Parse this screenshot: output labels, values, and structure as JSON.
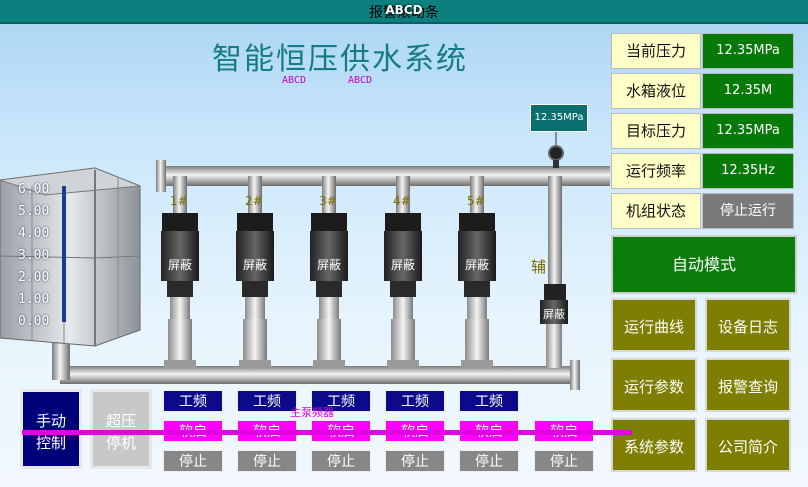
{
  "header": {
    "label": "报警滚动条",
    "overlay": "ABCD"
  },
  "title": "智能恒压供水系统",
  "subtitles": [
    "ABCD",
    "ABCD"
  ],
  "pressure_tag": "12.35MPa",
  "status_panel": [
    {
      "label": "当前压力",
      "value": "12.35MPa"
    },
    {
      "label": "水箱液位",
      "value": "12.35M"
    },
    {
      "label": "目标压力",
      "value": "12.35MPa"
    },
    {
      "label": "运行频率",
      "value": "12.35Hz"
    },
    {
      "label": "机组状态",
      "value": "停止运行"
    }
  ],
  "auto_mode": "自动模式",
  "menu": [
    "运行曲线",
    "设备日志",
    "运行参数",
    "报警查询",
    "系统参数",
    "公司简介"
  ],
  "tank_scale": [
    "6.00",
    "5.00",
    "4.00",
    "3.00",
    "2.00",
    "1.00",
    "0.00"
  ],
  "pumps": [
    {
      "label": "1#",
      "screen": "屏蔽",
      "mode": "工频",
      "start": "软启",
      "stop": "停止"
    },
    {
      "label": "2#",
      "screen": "屏蔽",
      "mode": "工频",
      "start": "软启",
      "stop": "停止"
    },
    {
      "label": "3#",
      "screen": "屏蔽",
      "mode": "工频",
      "start": "软启",
      "stop": "停止"
    },
    {
      "label": "4#",
      "screen": "屏蔽",
      "mode": "工频",
      "start": "软启",
      "stop": "停止"
    },
    {
      "label": "5#",
      "screen": "屏蔽",
      "mode": "工频",
      "start": "软启",
      "stop": "停止"
    }
  ],
  "aux_pump": {
    "label": "辅",
    "screen": "屏蔽",
    "start": "软启",
    "stop": "停止"
  },
  "manual_control": "手动\n控制",
  "overpressure_stop": "超压\n停机",
  "pump_bar_text": "主泵频器",
  "colors": {
    "teal": "#0c7f7f",
    "green": "#067a06",
    "olive": "#7e7e02",
    "magenta": "#ff00ff",
    "navy": "#0a0a8a"
  }
}
